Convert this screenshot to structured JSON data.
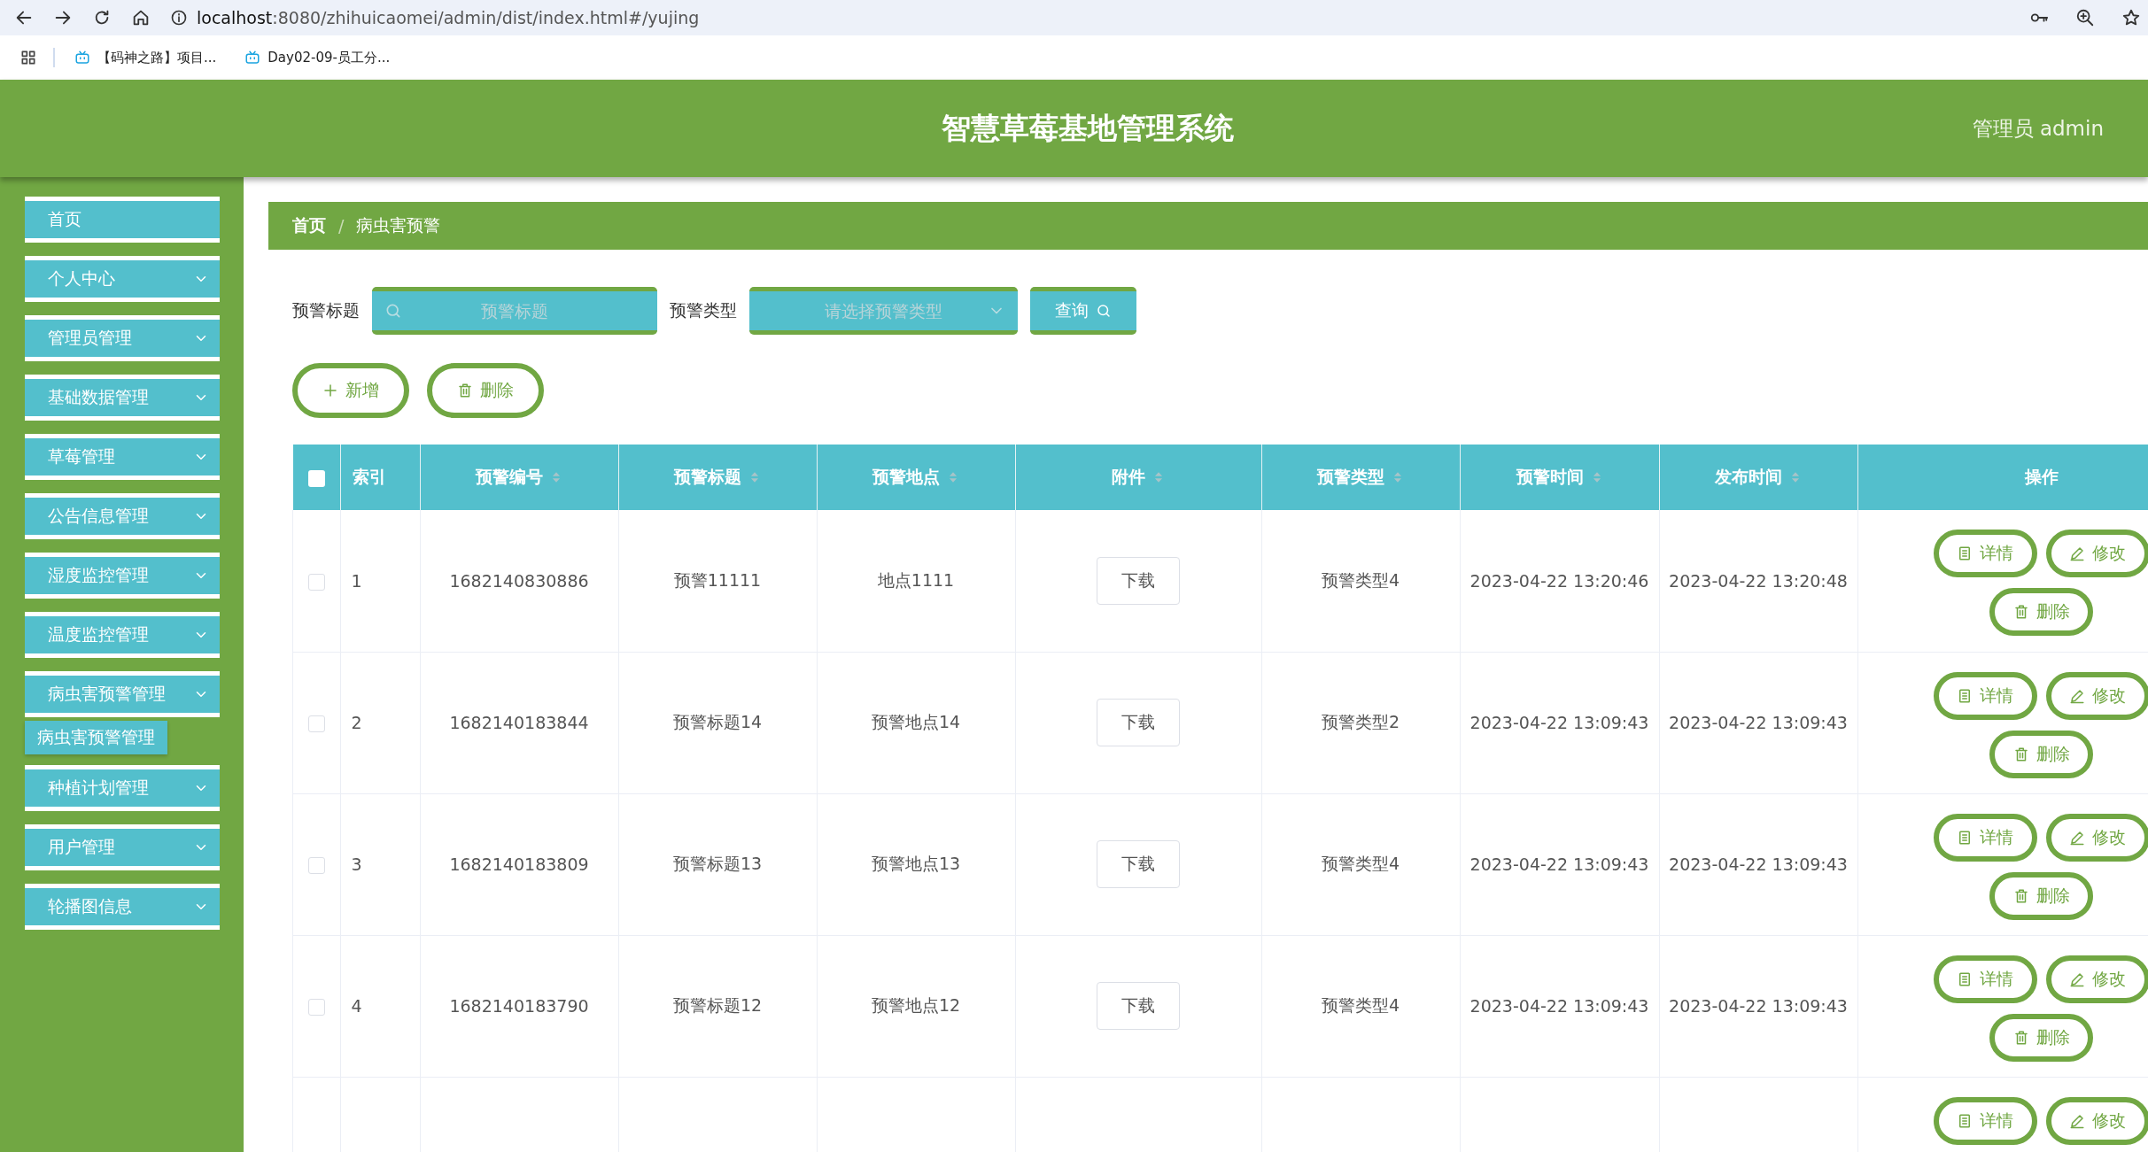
{
  "browser": {
    "url_host": "localhost",
    "url_rest": ":8080/zhihuicaomei/admin/dist/index.html#/yujing",
    "bookmarks": [
      "【码神之路】项目...",
      "Day02-09-员工分..."
    ]
  },
  "header": {
    "title": "智慧草莓基地管理系统",
    "user": "管理员 admin"
  },
  "sidebar": {
    "items": [
      {
        "label": "首页",
        "kind": "link"
      },
      {
        "label": "个人中心",
        "kind": "menu"
      },
      {
        "label": "管理员管理",
        "kind": "menu"
      },
      {
        "label": "基础数据管理",
        "kind": "menu"
      },
      {
        "label": "草莓管理",
        "kind": "menu"
      },
      {
        "label": "公告信息管理",
        "kind": "menu"
      },
      {
        "label": "湿度监控管理",
        "kind": "menu"
      },
      {
        "label": "温度监控管理",
        "kind": "menu"
      },
      {
        "label": "病虫害预警管理",
        "kind": "menu",
        "children": [
          {
            "label": "病虫害预警管理"
          }
        ]
      },
      {
        "label": "种植计划管理",
        "kind": "menu"
      },
      {
        "label": "用户管理",
        "kind": "menu"
      },
      {
        "label": "轮播图信息",
        "kind": "menu"
      }
    ]
  },
  "breadcrumb": [
    "首页",
    "病虫害预警"
  ],
  "breadcrumb_separator": "/",
  "filters": [
    {
      "label": "预警标题",
      "kind": "search",
      "placeholder": "预警标题"
    },
    {
      "label": "预警类型",
      "kind": "select",
      "placeholder": "请选择预警类型"
    }
  ],
  "query_button": "查询",
  "actions": [
    {
      "kind": "add",
      "label": "新增"
    },
    {
      "kind": "delete",
      "label": "删除"
    }
  ],
  "table": {
    "columns": [
      {
        "label": "索引",
        "sortable": false
      },
      {
        "label": "预警编号",
        "sortable": true
      },
      {
        "label": "预警标题",
        "sortable": true
      },
      {
        "label": "预警地点",
        "sortable": true
      },
      {
        "label": "附件",
        "sortable": true
      },
      {
        "label": "预警类型",
        "sortable": true
      },
      {
        "label": "预警时间",
        "sortable": true
      },
      {
        "label": "发布时间",
        "sortable": true
      },
      {
        "label": "操作",
        "sortable": false
      }
    ],
    "header_checked": false,
    "rows": [
      {
        "checked": false,
        "cells": [
          "1",
          "1682140830886",
          "预警11111",
          "地点1111"
        ],
        "attachment": "下载",
        "cells_after": [
          "预警类型4",
          "2023-04-22 13:20:46",
          "2023-04-22 13:20:48"
        ],
        "buttons": [
          {
            "kind": "detail",
            "label": "详情"
          },
          {
            "kind": "edit",
            "label": "修改"
          },
          {
            "kind": "delete",
            "label": "删除"
          }
        ]
      },
      {
        "checked": false,
        "cells": [
          "2",
          "1682140183844",
          "预警标题14",
          "预警地点14"
        ],
        "attachment": "下载",
        "cells_after": [
          "预警类型2",
          "2023-04-22 13:09:43",
          "2023-04-22 13:09:43"
        ],
        "buttons": [
          {
            "kind": "detail",
            "label": "详情"
          },
          {
            "kind": "edit",
            "label": "修改"
          },
          {
            "kind": "delete",
            "label": "删除"
          }
        ]
      },
      {
        "checked": false,
        "cells": [
          "3",
          "1682140183809",
          "预警标题13",
          "预警地点13"
        ],
        "attachment": "下载",
        "cells_after": [
          "预警类型4",
          "2023-04-22 13:09:43",
          "2023-04-22 13:09:43"
        ],
        "buttons": [
          {
            "kind": "detail",
            "label": "详情"
          },
          {
            "kind": "edit",
            "label": "修改"
          },
          {
            "kind": "delete",
            "label": "删除"
          }
        ]
      },
      {
        "checked": false,
        "cells": [
          "4",
          "1682140183790",
          "预警标题12",
          "预警地点12"
        ],
        "attachment": "下载",
        "cells_after": [
          "预警类型4",
          "2023-04-22 13:09:43",
          "2023-04-22 13:09:43"
        ],
        "buttons": [
          {
            "kind": "detail",
            "label": "详情"
          },
          {
            "kind": "edit",
            "label": "修改"
          },
          {
            "kind": "delete",
            "label": "删除"
          }
        ]
      },
      {
        "buttons": [
          {
            "kind": "detail",
            "label": "详情"
          },
          {
            "kind": "edit",
            "label": "修改"
          }
        ]
      }
    ]
  }
}
